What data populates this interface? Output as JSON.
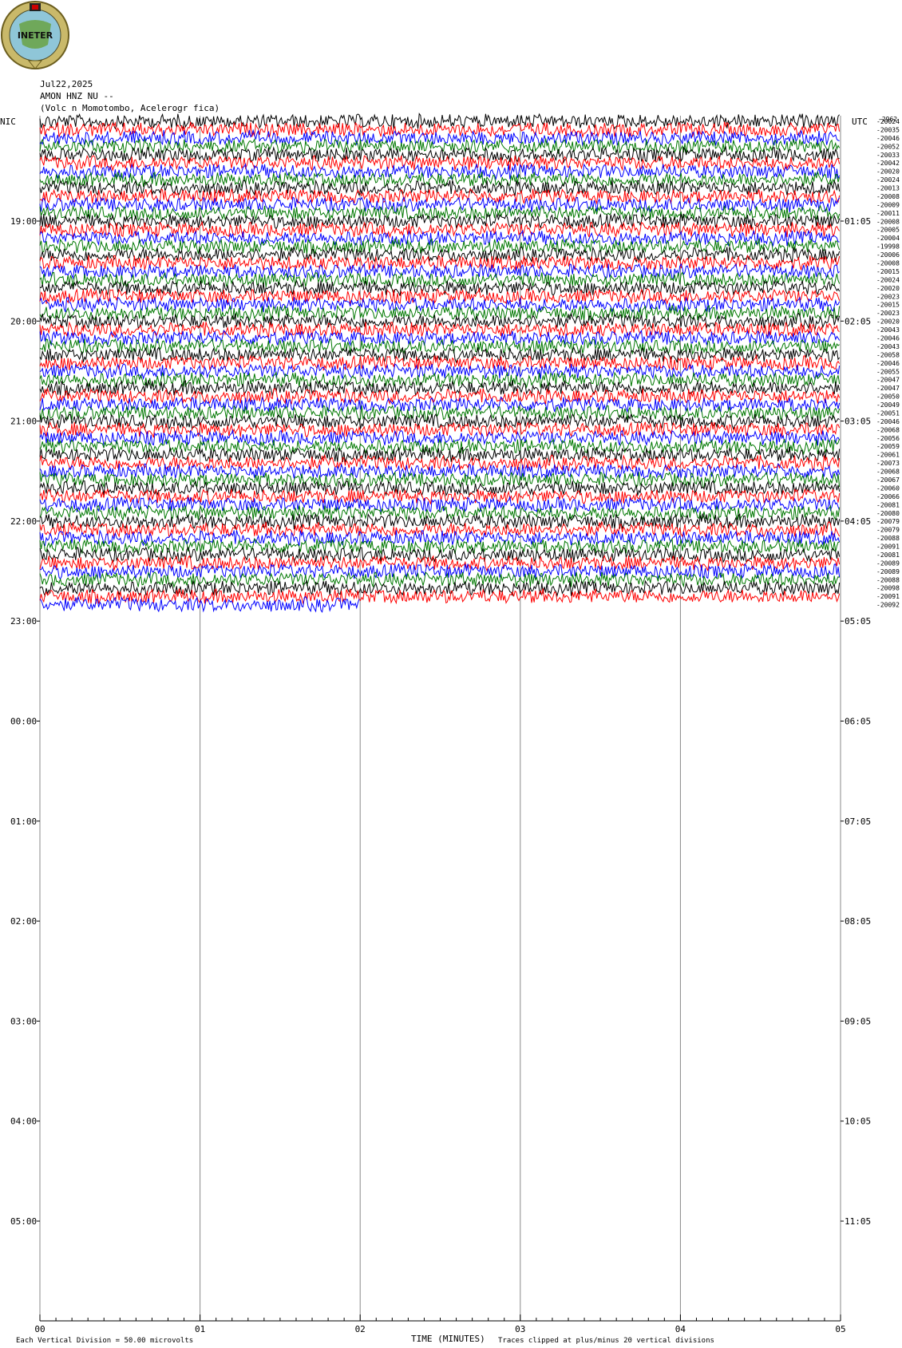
{
  "header": {
    "logo_text": "INETER",
    "date": "Jul22,2025",
    "station": "AMON HNZ NU --",
    "location": "(Volc n Momotombo, Acelerogr fica)"
  },
  "chart_data": {
    "type": "helicorder",
    "left_timezone": "NIC",
    "right_timezone": "UTC",
    "left_hour_labels": [
      "19:00",
      "20:00",
      "21:00",
      "22:00",
      "23:00",
      "00:00",
      "01:00",
      "02:00",
      "03:00",
      "04:00",
      "05:00"
    ],
    "right_hour_labels": [
      "01:05",
      "02:05",
      "03:05",
      "04:05",
      "05:05",
      "06:05",
      "07:05",
      "08:05",
      "09:05",
      "10:05",
      "11:05"
    ],
    "first_offset_label": "-2962",
    "trace_offsets": [
      "-20024",
      "-20035",
      "-20046",
      "-20052",
      "-20033",
      "-20042",
      "-20020",
      "-20024",
      "-20013",
      "-20008",
      "-20009",
      "-20011",
      "-20008",
      "-20005",
      "-20004",
      "-19998",
      "-20006",
      "-20008",
      "-20015",
      "-20024",
      "-20020",
      "-20023",
      "-20015",
      "-20023",
      "-20020",
      "-20043",
      "-20046",
      "-20043",
      "-20058",
      "-20046",
      "-20055",
      "-20047",
      "-20047",
      "-20050",
      "-20049",
      "-20051",
      "-20046",
      "-20068",
      "-20056",
      "-20059",
      "-20061",
      "-20073",
      "-20068",
      "-20067",
      "-20060",
      "-20066",
      "-20081",
      "-20080",
      "-20079",
      "-20079",
      "-20088",
      "-20091",
      "-20081",
      "-20089",
      "-20089",
      "-20088",
      "-20098",
      "-20091",
      "-20092"
    ],
    "trace_colors": [
      "#000000",
      "#ff0000",
      "#0000ff",
      "#007800"
    ],
    "rows_per_hour": 12,
    "minutes_per_row": 5,
    "total_rows": 59,
    "partial_last_row_minutes": 2.0,
    "x_axis": {
      "label": "TIME (MINUTES)",
      "range": [
        0,
        5
      ],
      "tick_labels": [
        "00",
        "01",
        "02",
        "03",
        "04",
        "05"
      ]
    },
    "footer_left": "Each Vertical Division =   50.00 microvolts",
    "footer_right": "Traces clipped at plus/minus 20 vertical divisions"
  }
}
